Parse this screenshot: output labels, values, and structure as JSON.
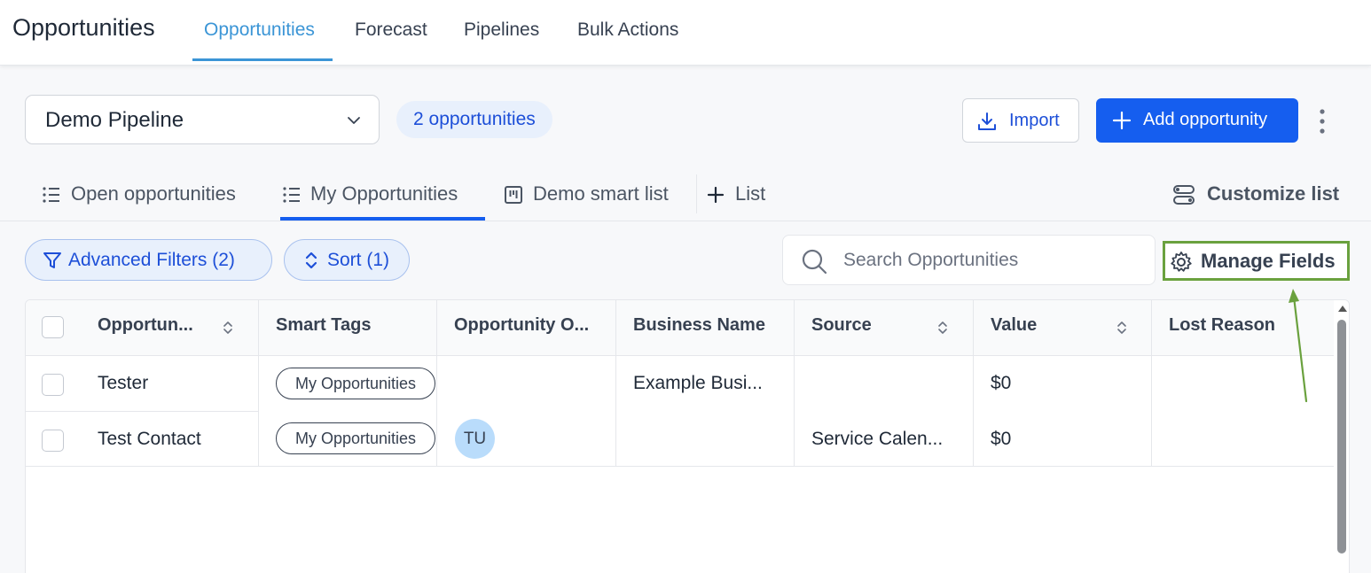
{
  "app": {
    "title": "Opportunities"
  },
  "nav": {
    "tabs": [
      {
        "label": "Opportunities",
        "active": true
      },
      {
        "label": "Forecast"
      },
      {
        "label": "Pipelines"
      },
      {
        "label": "Bulk Actions"
      }
    ]
  },
  "header": {
    "pipeline_value": "Demo Pipeline",
    "count_badge": "2 opportunities",
    "import_label": "Import",
    "add_label": "Add opportunity"
  },
  "list_tabs": {
    "items": [
      {
        "label": "Open opportunities",
        "icon": "list-icon"
      },
      {
        "label": "My Opportunities",
        "icon": "list-icon",
        "active": true
      },
      {
        "label": "Demo smart list",
        "icon": "kanban-icon"
      },
      {
        "label": "List",
        "icon": "plus-icon"
      }
    ],
    "customize_label": "Customize list"
  },
  "filters": {
    "advanced_label": "Advanced Filters (2)",
    "sort_label": "Sort (1)",
    "search_placeholder": "Search Opportunities",
    "manage_label": "Manage Fields"
  },
  "table": {
    "headers": [
      "Opportun...",
      "Smart Tags",
      "Opportunity O...",
      "Business Name",
      "Source",
      "Value",
      "Lost Reason"
    ],
    "rows": [
      {
        "name": "Tester",
        "tag": "My Opportunities",
        "owner": "",
        "business": "Example Busi...",
        "source": "",
        "value": "$0",
        "lost_reason": ""
      },
      {
        "name": "Test Contact",
        "tag": "My Opportunities",
        "owner": "TU",
        "business": "",
        "source": "Service Calen...",
        "value": "$0",
        "lost_reason": ""
      }
    ]
  },
  "colors": {
    "primary": "#155eef",
    "nav_active": "#3b95d6",
    "highlight_box": "#6aa13e",
    "avatar_bg": "#b9dcfb"
  }
}
